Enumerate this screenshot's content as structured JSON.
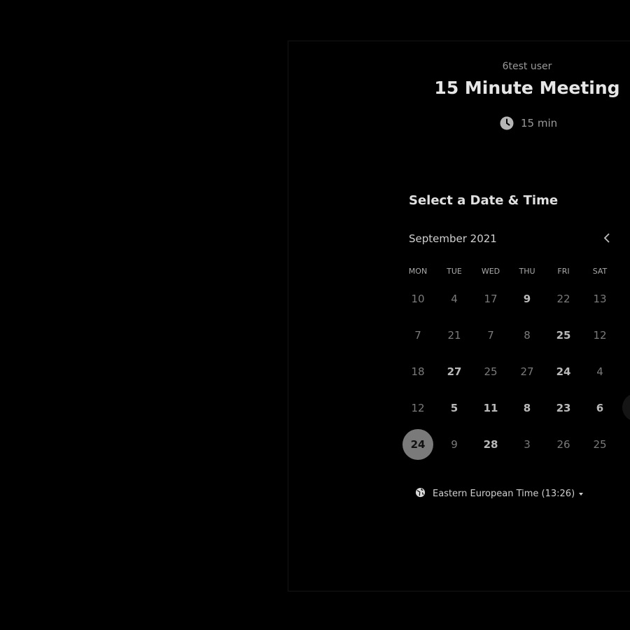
{
  "event": {
    "user_name": "6test user",
    "title": "15 Minute Meeting",
    "duration": "15 min"
  },
  "calendar": {
    "section_title": "Select a Date & Time",
    "month": "September 2021",
    "weekdays": [
      "MON",
      "TUE",
      "WED",
      "THU",
      "FRI",
      "SAT"
    ],
    "weeks": [
      [
        {
          "d": "10",
          "a": false
        },
        {
          "d": "4",
          "a": false
        },
        {
          "d": "17",
          "a": false
        },
        {
          "d": "9",
          "a": true
        },
        {
          "d": "22",
          "a": false
        },
        {
          "d": "13",
          "a": false
        }
      ],
      [
        {
          "d": "7",
          "a": false
        },
        {
          "d": "21",
          "a": false
        },
        {
          "d": "7",
          "a": false
        },
        {
          "d": "8",
          "a": false
        },
        {
          "d": "25",
          "a": true
        },
        {
          "d": "12",
          "a": false
        }
      ],
      [
        {
          "d": "18",
          "a": false
        },
        {
          "d": "27",
          "a": true
        },
        {
          "d": "25",
          "a": false
        },
        {
          "d": "27",
          "a": false
        },
        {
          "d": "24",
          "a": true
        },
        {
          "d": "4",
          "a": false
        }
      ],
      [
        {
          "d": "12",
          "a": false
        },
        {
          "d": "5",
          "a": true
        },
        {
          "d": "11",
          "a": true
        },
        {
          "d": "8",
          "a": true
        },
        {
          "d": "23",
          "a": true
        },
        {
          "d": "6",
          "a": true
        }
      ],
      [
        {
          "d": "24",
          "a": true,
          "selected": true
        },
        {
          "d": "9",
          "a": false
        },
        {
          "d": "28",
          "a": true
        },
        {
          "d": "3",
          "a": false
        },
        {
          "d": "26",
          "a": false
        },
        {
          "d": "25",
          "a": false
        }
      ]
    ]
  },
  "timezone": {
    "label": "Eastern European Time (13:26)"
  },
  "colors": {
    "background": "#000000",
    "selected_day": "#7a7a7a",
    "available_text": "#b9b9b9",
    "unavailable_text": "#7a7a7a"
  },
  "icons": {
    "duration": "clock-icon",
    "prev": "chevron-left-icon",
    "timezone": "globe-icon",
    "timezone_dropdown": "caret-down-icon"
  }
}
